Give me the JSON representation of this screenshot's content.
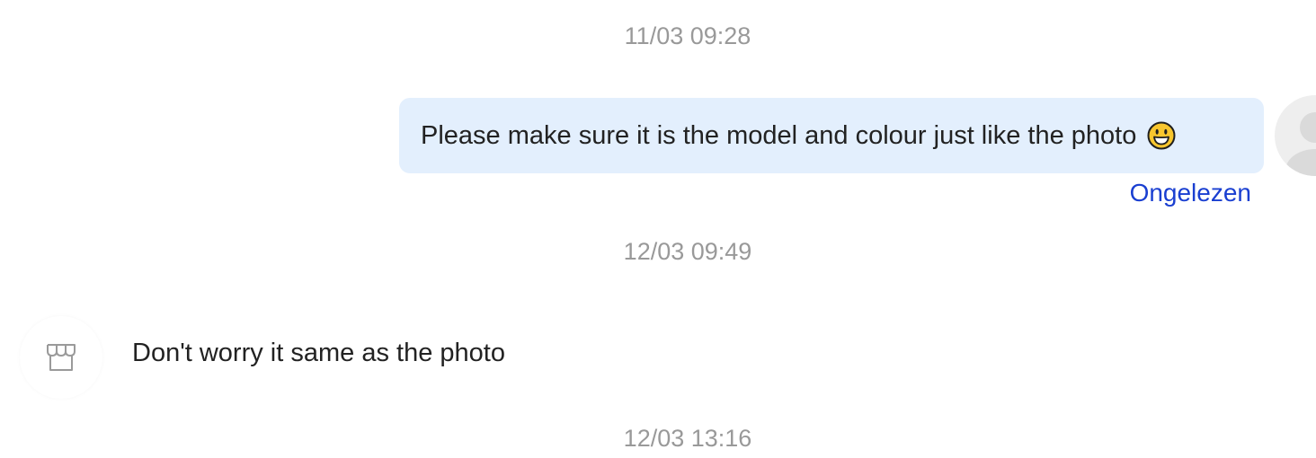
{
  "conversation": {
    "messages": [
      {
        "timestamp": "11/03 09:28",
        "direction": "outgoing",
        "text": "Please make sure it is the model and colour just like the photo",
        "emoji": "grinning-face-emoji",
        "status": "Ongelezen"
      },
      {
        "timestamp": "12/03 09:49",
        "direction": "incoming",
        "text": "Don't worry it same as the photo",
        "avatar_icon": "storefront-icon"
      },
      {
        "timestamp": "12/03 13:16"
      }
    ]
  },
  "colors": {
    "outgoing_bubble": "#e3effd",
    "status_text": "#1a3fd1",
    "timestamp_text": "#999999"
  }
}
